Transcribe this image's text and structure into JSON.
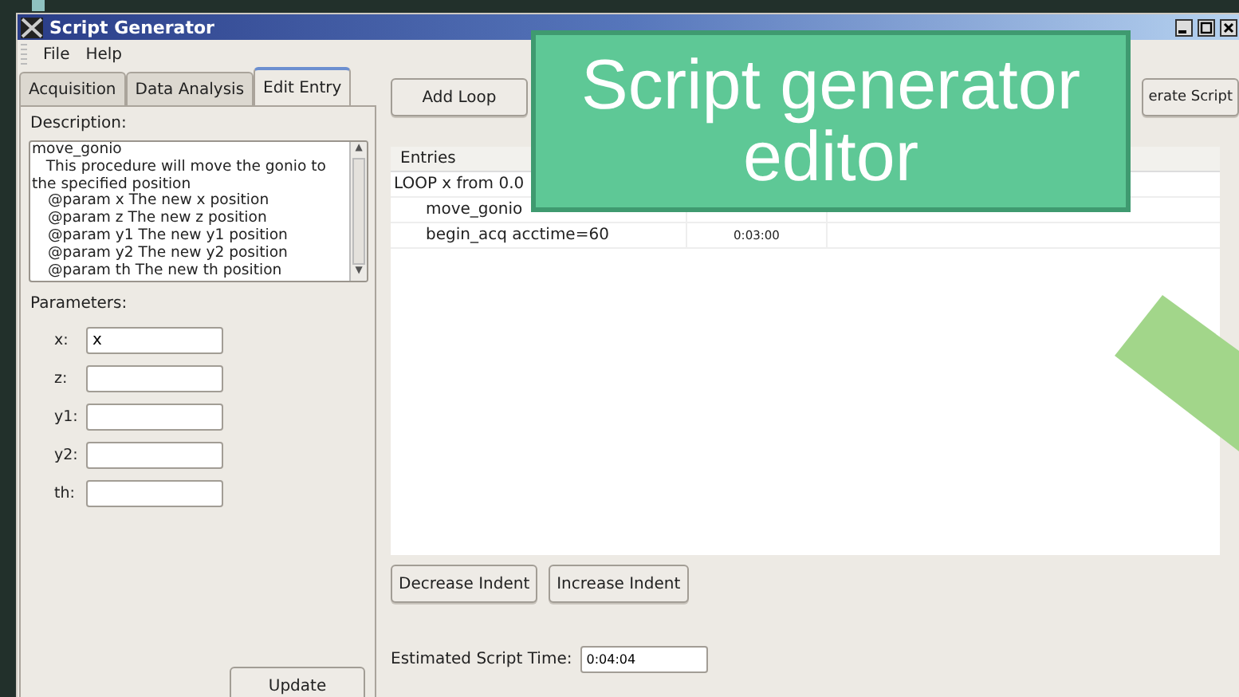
{
  "window": {
    "title": "Script Generator"
  },
  "menu": [
    "File",
    "Help"
  ],
  "tabs": [
    {
      "label": "Acquisition",
      "selected": false
    },
    {
      "label": "Data Analysis",
      "selected": false
    },
    {
      "label": "Edit Entry",
      "selected": true
    }
  ],
  "description": {
    "label": "Description:",
    "lines": [
      {
        "text": "move_gonio",
        "indent": false
      },
      {
        "text": "   This procedure will move the gonio to the specified position",
        "indent": false
      },
      {
        "text": "@param x The new x position",
        "indent": true
      },
      {
        "text": "@param z The new z position",
        "indent": true
      },
      {
        "text": "@param y1 The new y1 position",
        "indent": true
      },
      {
        "text": "@param y2 The new y2 position",
        "indent": true
      },
      {
        "text": "@param th The new th position",
        "indent": true
      }
    ]
  },
  "parameters": {
    "label": "Parameters:",
    "fields": [
      {
        "label": "x:",
        "value": "x"
      },
      {
        "label": "z:"
      },
      {
        "label": "y1:"
      },
      {
        "label": "y2:"
      },
      {
        "label": "th:"
      }
    ]
  },
  "update_button": "Update",
  "toolbar": {
    "add_loop": "Add Loop",
    "generate": "erate Script"
  },
  "scroll_arrows": [
    "▲",
    "▼"
  ],
  "table": {
    "columns": [
      "Entries"
    ],
    "rows": [
      {
        "entry": "LOOP x from 0.0",
        "children": [
          {
            "entry": "move_gonio"
          },
          {
            "entry": "begin_acq acctime=60",
            "time": "0:03:00"
          }
        ]
      }
    ]
  },
  "indent_buttons": [
    "Decrease Indent",
    "Increase Indent"
  ],
  "estimate": {
    "label": "Estimated Script Time:",
    "value": "0:04:04"
  },
  "callout": {
    "lines": [
      "Script generator",
      "editor"
    ]
  }
}
